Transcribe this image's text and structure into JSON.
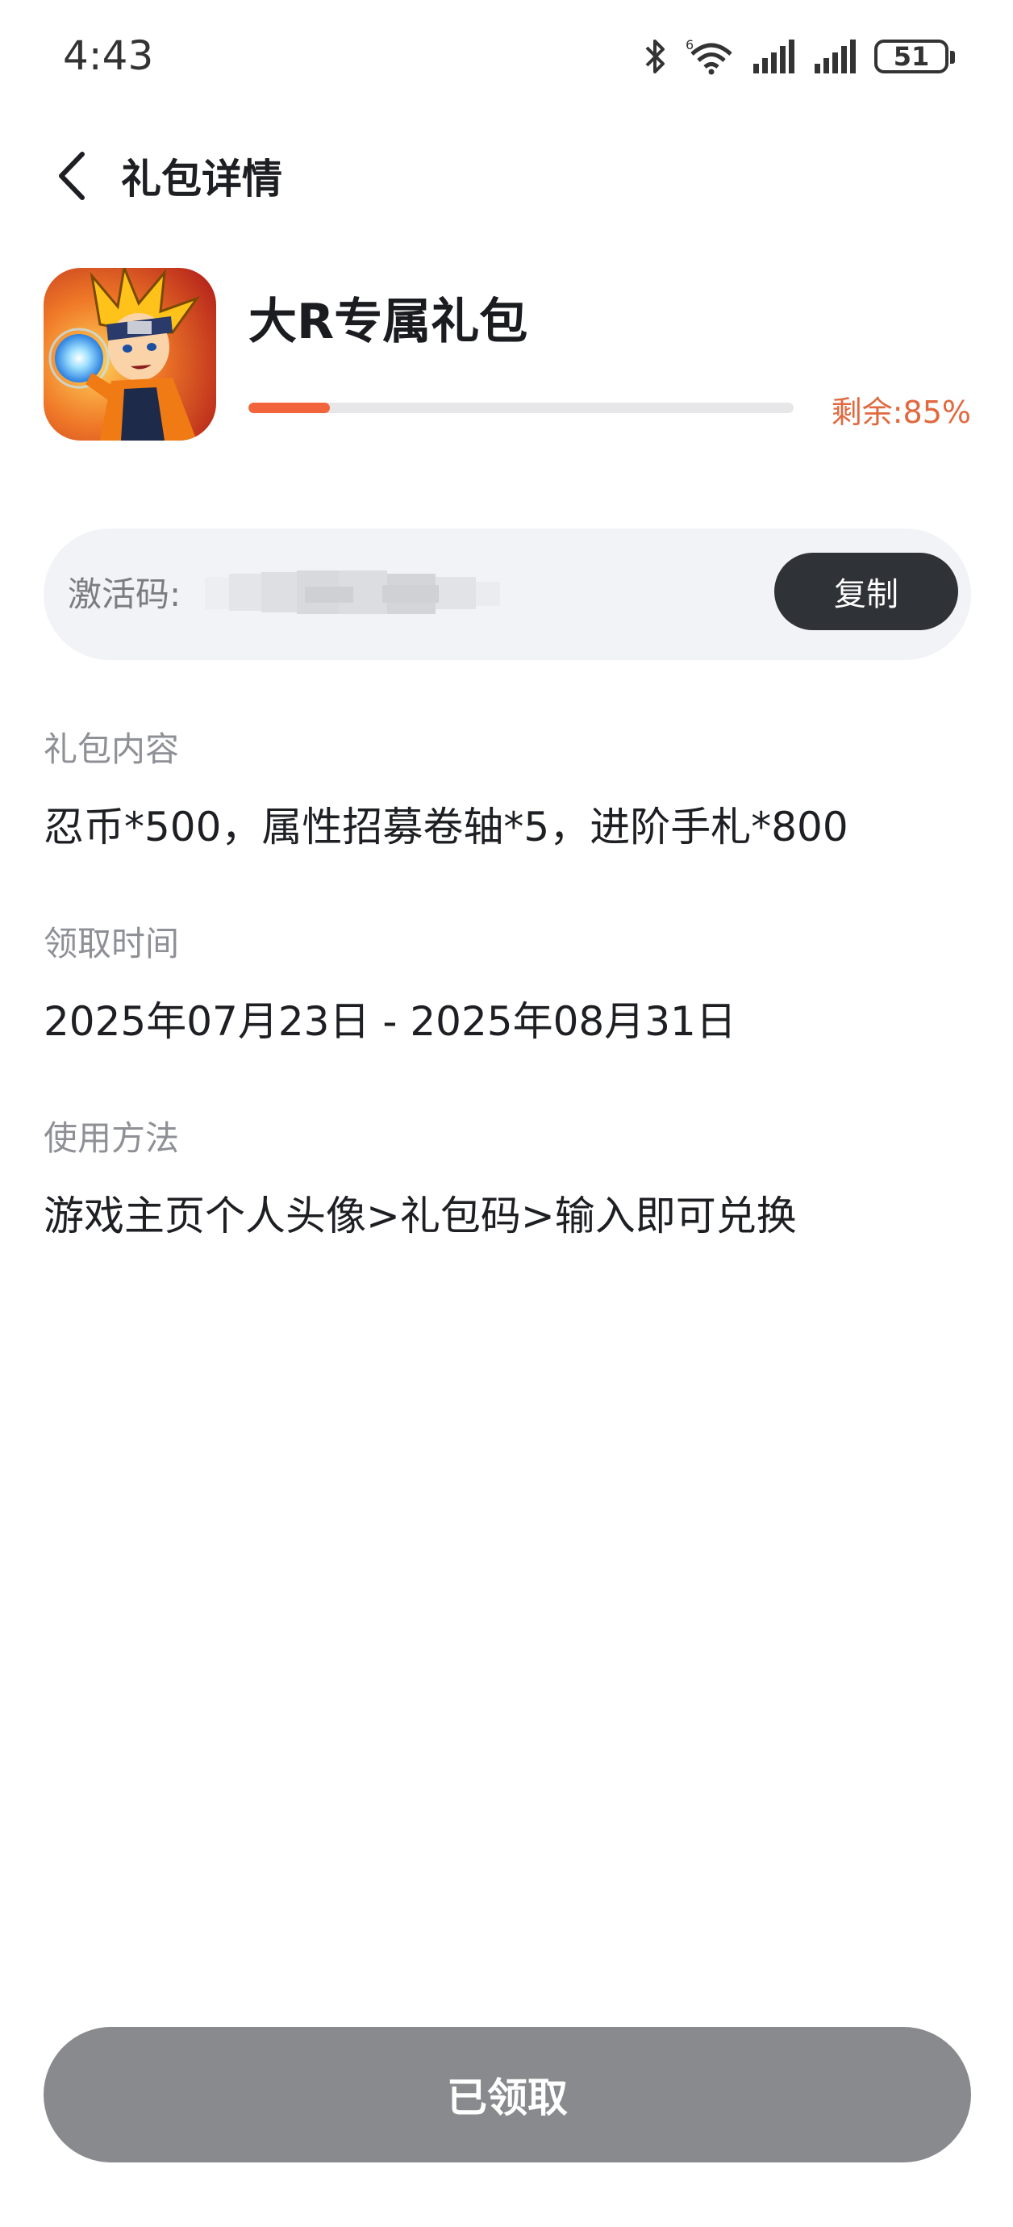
{
  "status_bar": {
    "time": "4:43",
    "battery_level": "51",
    "icons": [
      "bluetooth-icon",
      "wifi-icon",
      "signal-icon",
      "signal-icon",
      "battery-icon"
    ]
  },
  "header": {
    "title": "礼包详情",
    "back_icon": "back-arrow-icon"
  },
  "gift": {
    "name": "大R专属礼包",
    "progress_fraction": 0.15,
    "remain_text": "剩余:85%",
    "progress_color": "#f2643c",
    "remain_color": "#e0693f"
  },
  "activation": {
    "label": "激活码:",
    "copy_label": "复制"
  },
  "sections": {
    "content_label": "礼包内容",
    "content_value": "忍币*500，属性招募卷轴*5，进阶手札*800",
    "time_label": "领取时间",
    "time_value": "2025年07月23日 - 2025年08月31日",
    "usage_label": "使用方法",
    "usage_value": "游戏主页个人头像>礼包码>输入即可兑换"
  },
  "footer": {
    "button_label": "已领取",
    "button_color": "#898a8d"
  }
}
